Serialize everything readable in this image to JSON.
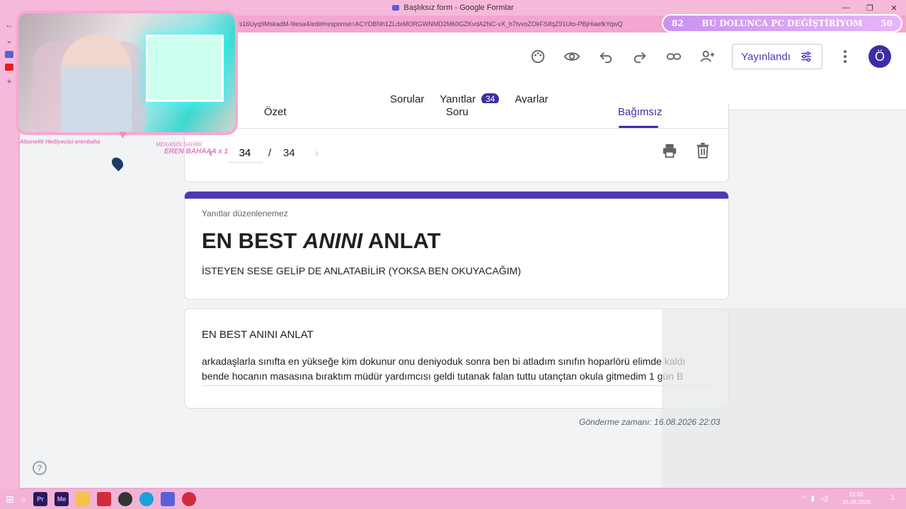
{
  "window": {
    "title": "Başlıksız form - Google Formlar"
  },
  "browser": {
    "url": "s16Uyq9MskadM-9iesa4/edit#response=ACYDBNh1ZLdxMORGWNMD2M60GZKvdA2NC-vX_h7tvvoZOkFSIfqZ91Uto-PBjHiaefkYqwQ"
  },
  "toolbar": {
    "publish_label": "Yayınlandı",
    "avatar_letter": "Ö"
  },
  "main_tabs": [
    {
      "label": "Sorular"
    },
    {
      "label": "Yanıtlar",
      "count": "34"
    },
    {
      "label": "Ayarlar"
    }
  ],
  "sub_tabs": [
    {
      "label": "Özet"
    },
    {
      "label": "Soru"
    },
    {
      "label": "Bağımsız"
    }
  ],
  "pager": {
    "current": "34",
    "separator": "/",
    "total": "34"
  },
  "form": {
    "note": "Yanıtlar düzenlenemez",
    "title_part1": "EN BEST ",
    "title_part2": "ANINI",
    "title_part3": " ANLAT",
    "description": "İSTEYEN SESE GELİP DE ANLATABİLİR (YOKSA BEN OKUYACAĞIM)"
  },
  "answer": {
    "question": "EN BEST ANINI ANLAT",
    "text": "arkadaşlarla sınıfta en yükseğe kim dokunur onu deniyoduk sonra ben bi atladım sınıfın hoparlörü elimde kaldı bende hocanın masasına bıraktım müdür yardımcısı geldi tutanak falan tuttu utançtan okula gitmedim 1 gün B",
    "submitted": "Gönderme zamanı: 16.08.2026 22:03"
  },
  "overlay": {
    "sub_gift": "Abonelik Hediyecisi erenbaha",
    "owner_title": "MEKANIN SAHİBİ",
    "owner_name": "EREN BAHAAA x 1",
    "goal_left": "82",
    "goal_text": "BU DOLUNCA PC DEĞİŞTİRİYOM",
    "goal_right": "50"
  },
  "taskbar": {
    "time": "22:05",
    "date": "16.08.2026",
    "notif": "1",
    "apps": [
      "Pr",
      "Me"
    ]
  },
  "colors": {
    "accent": "#4a3ab5",
    "pink": "#f3a6cf"
  }
}
